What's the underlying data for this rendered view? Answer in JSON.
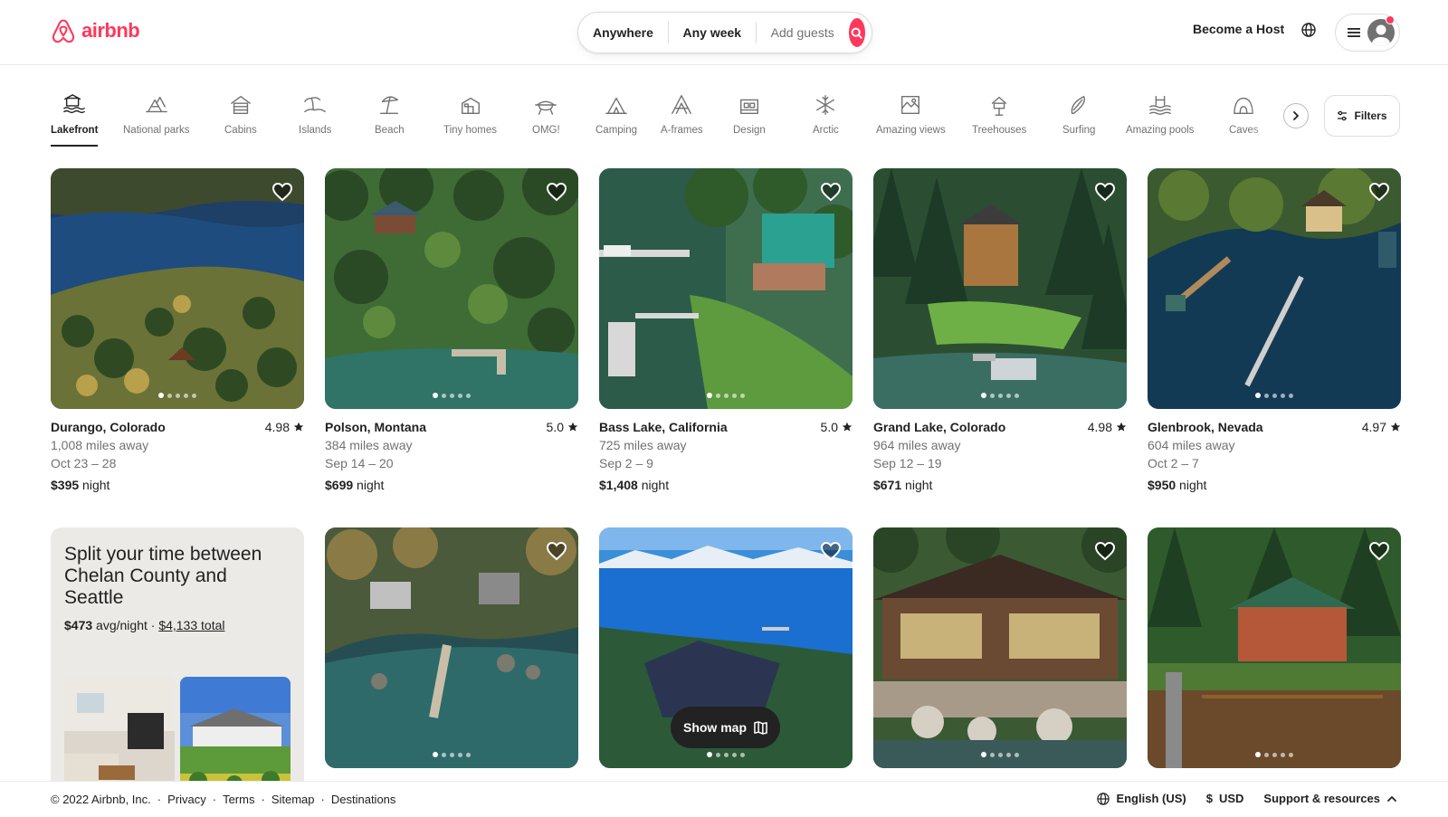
{
  "brand": {
    "name": "airbnb",
    "color": "#ff385c"
  },
  "search": {
    "where": "Anywhere",
    "when": "Any week",
    "who": "Add guests"
  },
  "header": {
    "host_link": "Become a Host"
  },
  "categories": [
    {
      "label": "Lakefront",
      "icon": "lakefront-icon",
      "active": true
    },
    {
      "label": "National parks",
      "icon": "national-parks-icon"
    },
    {
      "label": "Cabins",
      "icon": "cabins-icon"
    },
    {
      "label": "Islands",
      "icon": "islands-icon"
    },
    {
      "label": "Beach",
      "icon": "beach-icon"
    },
    {
      "label": "Tiny homes",
      "icon": "tiny-homes-icon"
    },
    {
      "label": "OMG!",
      "icon": "omg-icon"
    },
    {
      "label": "Camping",
      "icon": "camping-icon"
    },
    {
      "label": "A-frames",
      "icon": "a-frames-icon"
    },
    {
      "label": "Design",
      "icon": "design-icon"
    },
    {
      "label": "Arctic",
      "icon": "arctic-icon"
    },
    {
      "label": "Amazing views",
      "icon": "amazing-views-icon"
    },
    {
      "label": "Treehouses",
      "icon": "treehouses-icon"
    },
    {
      "label": "Surfing",
      "icon": "surfing-icon"
    },
    {
      "label": "Amazing pools",
      "icon": "amazing-pools-icon"
    },
    {
      "label": "Caves",
      "icon": "caves-icon"
    }
  ],
  "filters_label": "Filters",
  "listings": [
    {
      "location": "Durango, Colorado",
      "rating": "4.98",
      "distance": "1,008 miles away",
      "dates": "Oct 23 – 28",
      "price": "$395",
      "unit": "night"
    },
    {
      "location": "Polson, Montana",
      "rating": "5.0",
      "distance": "384 miles away",
      "dates": "Sep 14 – 20",
      "price": "$699",
      "unit": "night"
    },
    {
      "location": "Bass Lake, California",
      "rating": "5.0",
      "distance": "725 miles away",
      "dates": "Sep 2 – 9",
      "price": "$1,408",
      "unit": "night"
    },
    {
      "location": "Grand Lake, Colorado",
      "rating": "4.98",
      "distance": "964 miles away",
      "dates": "Sep 12 – 19",
      "price": "$671",
      "unit": "night"
    },
    {
      "location": "Glenbrook, Nevada",
      "rating": "4.97",
      "distance": "604 miles away",
      "dates": "Oct 2 – 7",
      "price": "$950",
      "unit": "night"
    }
  ],
  "promo": {
    "title": "Split your time between Chelan County and Seattle",
    "avg_price": "$473",
    "avg_suffix": "avg/night ·",
    "total": "$4,133 total"
  },
  "show_map_label": "Show map",
  "footer": {
    "copyright": "© 2022 Airbnb, Inc.",
    "links": [
      "Privacy",
      "Terms",
      "Sitemap",
      "Destinations"
    ],
    "language": "English (US)",
    "currency_symbol": "$",
    "currency": "USD",
    "support": "Support & resources"
  }
}
